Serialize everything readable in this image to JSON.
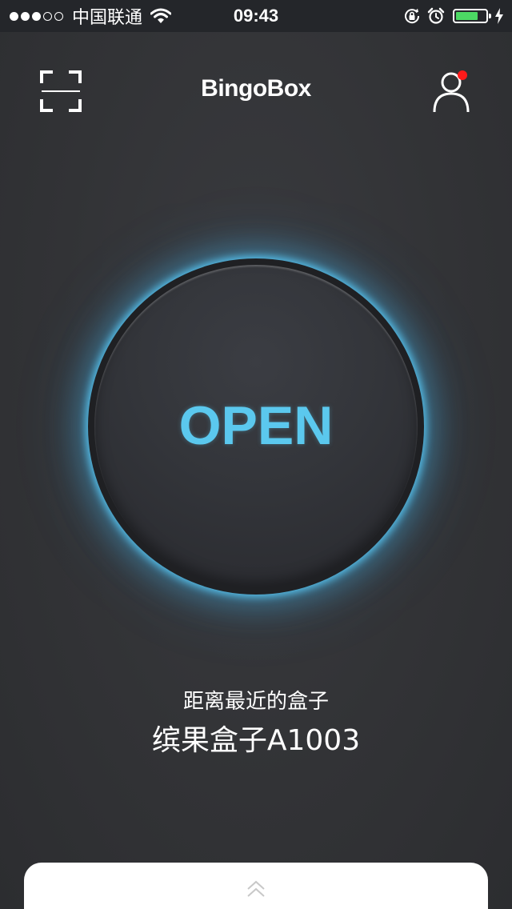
{
  "status_bar": {
    "signal_filled": 3,
    "signal_total": 5,
    "carrier": "中国联通",
    "time": "09:43",
    "battery_level": 0.75,
    "battery_color": "#4cd964",
    "icons": [
      "wifi-icon",
      "rotation-lock-icon",
      "alarm-icon",
      "battery-icon",
      "charging-bolt-icon"
    ]
  },
  "header": {
    "logo": "BingoBox",
    "left_icon": "scan-icon",
    "right_icon": "profile-icon",
    "notification_color": "#ff1a1a"
  },
  "main": {
    "open_label": "OPEN",
    "accent_color": "#5bc8ee",
    "nearest_caption": "距离最近的盒子",
    "nearest_box_name": "缤果盒子A1003"
  },
  "drawer": {
    "icon": "chevron-up-icon"
  }
}
